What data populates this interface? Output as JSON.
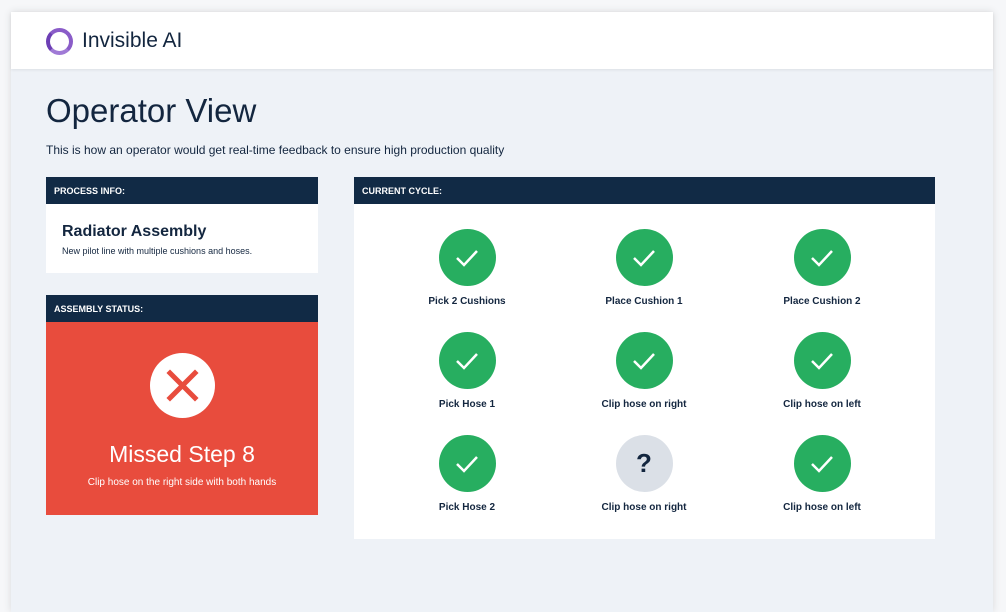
{
  "app": {
    "brand": "Invisible AI"
  },
  "page": {
    "title": "Operator View",
    "subtitle": "This is how an operator would get real-time feedback to ensure high production quality"
  },
  "process": {
    "header": "PROCESS INFO:",
    "name": "Radiator Assembly",
    "description": "New pilot line with multiple cushions and hoses."
  },
  "assembly": {
    "header": "ASSEMBLY STATUS:",
    "status": "Missed Step 8",
    "detail": "Clip hose on the right side with both hands",
    "color": "#e84c3d"
  },
  "cycle": {
    "header": "CURRENT CYCLE:",
    "steps": [
      {
        "label": "Pick 2 Cushions",
        "state": "done"
      },
      {
        "label": "Place Cushion 1",
        "state": "done"
      },
      {
        "label": "Place Cushion 2",
        "state": "done"
      },
      {
        "label": "Pick Hose 1",
        "state": "done"
      },
      {
        "label": "Clip hose on right",
        "state": "done"
      },
      {
        "label": "Clip hose on left",
        "state": "done"
      },
      {
        "label": "Pick Hose 2",
        "state": "done"
      },
      {
        "label": "Clip hose on right",
        "state": "unknown",
        "symbol": "?"
      },
      {
        "label": "Clip hose on left",
        "state": "done"
      }
    ]
  }
}
